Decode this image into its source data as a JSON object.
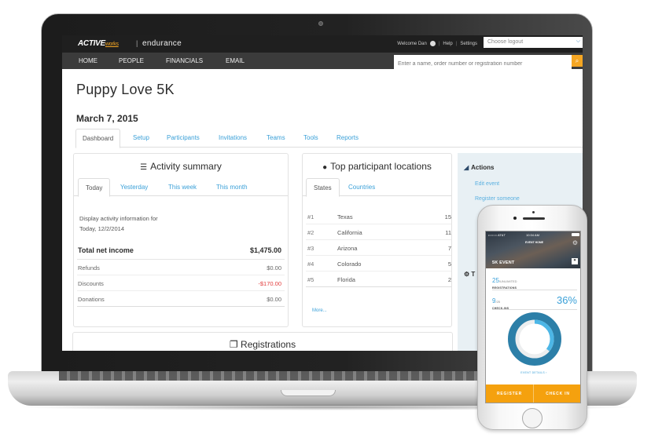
{
  "app": {
    "brand": "ACTIVE",
    "brand_suffix": "works",
    "product": "endurance",
    "separator": "|"
  },
  "topbar": {
    "welcome": "Welcome Dan",
    "help": "Help",
    "settings": "Settings",
    "logout_select": {
      "value": "Choose logout"
    }
  },
  "nav": {
    "items": [
      {
        "label": "HOME"
      },
      {
        "label": "PEOPLE"
      },
      {
        "label": "FINANCIALS"
      },
      {
        "label": "EMAIL"
      }
    ],
    "search": {
      "placeholder": "Enter a name, order number or registration number",
      "button_icon": "search-icon"
    }
  },
  "event": {
    "title": "Puppy Love 5K",
    "date": "March 7, 2015"
  },
  "tabs": [
    {
      "label": "Dashboard",
      "active": true
    },
    {
      "label": "Setup"
    },
    {
      "label": "Participants"
    },
    {
      "label": "Invitations"
    },
    {
      "label": "Teams"
    },
    {
      "label": "Tools"
    },
    {
      "label": "Reports"
    }
  ],
  "activity": {
    "title": "Activity summary",
    "icon": "list-icon",
    "subtabs": [
      {
        "label": "Today",
        "active": true
      },
      {
        "label": "Yesterday"
      },
      {
        "label": "This week"
      },
      {
        "label": "This month"
      }
    ],
    "description_line1": "Display activity information for",
    "description_line2": "Today, 12/2/2014",
    "total": {
      "label": "Total net income",
      "value": "$1,475.00"
    },
    "rows": [
      {
        "label": "Refunds",
        "value": "$0.00"
      },
      {
        "label": "Discounts",
        "value": "-$170.00",
        "negative": true
      },
      {
        "label": "Donations",
        "value": "$0.00"
      }
    ]
  },
  "locations": {
    "title": "Top participant locations",
    "icon": "globe-icon",
    "subtabs": [
      {
        "label": "States",
        "active": true
      },
      {
        "label": "Countries"
      }
    ],
    "rows": [
      {
        "rank": "#1",
        "state": "Texas",
        "count": "15"
      },
      {
        "rank": "#2",
        "state": "California",
        "count": "11"
      },
      {
        "rank": "#3",
        "state": "Arizona",
        "count": "7"
      },
      {
        "rank": "#4",
        "state": "Colorado",
        "count": "5"
      },
      {
        "rank": "#5",
        "state": "Florida",
        "count": "2"
      }
    ],
    "more_link": "More..."
  },
  "actions": {
    "title": "Actions",
    "icon": "chart-icon",
    "links": [
      {
        "label": "Edit event"
      },
      {
        "label": "Register someone"
      }
    ],
    "tools_title_initial": "T",
    "tools_icon": "gear-icon"
  },
  "registrations": {
    "title": "Registrations",
    "icon": "copy-icon"
  },
  "phone": {
    "status": {
      "carrier": "•○○○○ AT&T",
      "time": "10:34 AM"
    },
    "header_title": "EVENT HOME",
    "event_name": "5K EVENT",
    "registrations": {
      "count": "25",
      "limit": "/UNLIMITED",
      "caption": "REGISTRATIONS"
    },
    "checkins": {
      "count": "9",
      "total": "/25",
      "caption": "CHECK-INS",
      "percent_label": "36%",
      "percent": 36
    },
    "details_link": "EVENT DETAILS ›",
    "buttons": {
      "register": "REGISTER",
      "checkin": "CHECK IN"
    },
    "colors": {
      "accent": "#3aa0d8",
      "ring": "#2c7fa8",
      "orange": "#f5a10e"
    }
  }
}
